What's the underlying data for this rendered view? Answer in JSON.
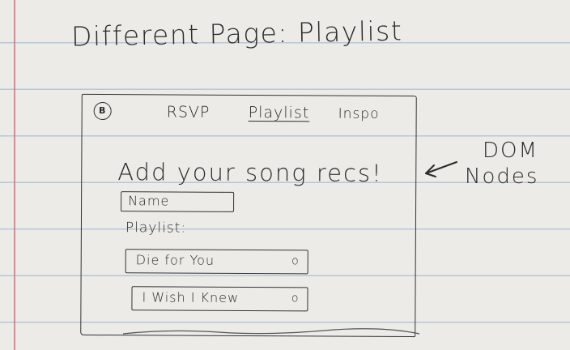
{
  "heading": "Different Page: Playlist",
  "sketch": {
    "logo_text": "B",
    "nav": {
      "items": [
        "RSVP",
        "Playlist",
        "Inspo"
      ],
      "active": "Playlist"
    },
    "title": "Add your song recs!",
    "name_field": {
      "placeholder": "Name"
    },
    "playlist_label": "Playlist:",
    "songs": [
      {
        "title": "Die for You",
        "remove_icon": "circle-icon"
      },
      {
        "title": "I Wish I Knew",
        "remove_icon": "circle-icon"
      }
    ]
  },
  "annotation": {
    "line1": "DOM",
    "line2": "Nodes",
    "arrow_icon": "left-arrow-icon"
  },
  "colors": {
    "ink": "#2b2b2b",
    "paper": "#ecebe7",
    "rule_line": "#b9c6d6",
    "margin_line": "#d46a7a"
  }
}
